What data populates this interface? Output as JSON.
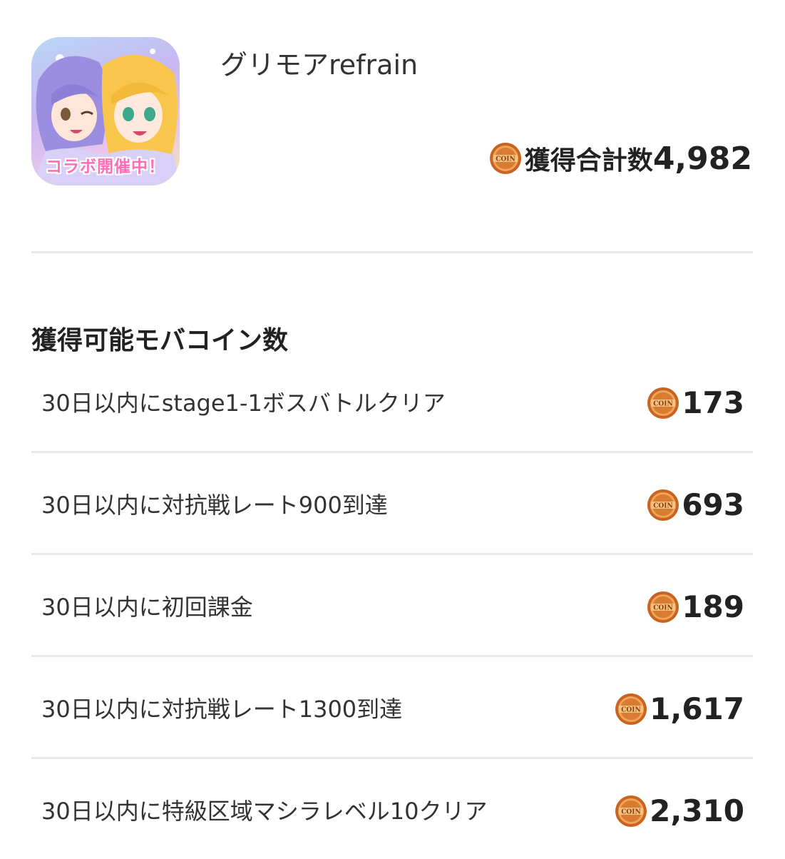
{
  "app": {
    "name": "グリモアrefrain",
    "icon_banner": "コラボ開催中！",
    "icon_name": "app-icon"
  },
  "total": {
    "label": "獲得合計数",
    "value": "4,982",
    "icon": "coin-icon"
  },
  "section": {
    "title": "獲得可能モバコイン数"
  },
  "missions": [
    {
      "label": "30日以内にstage1-1ボスバトルクリア",
      "reward": "173"
    },
    {
      "label": "30日以内に対抗戦レート900到達",
      "reward": "693"
    },
    {
      "label": "30日以内に初回課金",
      "reward": "189"
    },
    {
      "label": "30日以内に対抗戦レート1300到達",
      "reward": "1,617"
    },
    {
      "label": "30日以内に特級区域マシラレベル10クリア",
      "reward": "2,310"
    }
  ],
  "coin_text": "COIN",
  "colors": {
    "coin_main": "#c8641f",
    "coin_light": "#f0a35a",
    "coin_dark": "#8a3c0c",
    "divider": "#e9e9e9",
    "text": "#222222"
  }
}
